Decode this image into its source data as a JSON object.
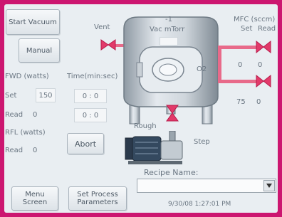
{
  "buttons": {
    "start_vacuum": "Start Vacuum",
    "manual": "Manual",
    "abort": "Abort",
    "menu_screen": "Menu Screen",
    "set_process_parameters": "Set Process Parameters"
  },
  "labels": {
    "vent": "Vent",
    "vac": "Vac mTorr",
    "vac_value": "-1",
    "mfc_header": "MFC (sccm)",
    "mfc_set": "Set",
    "mfc_read": "Read",
    "fwd": "FWD (watts)",
    "time": "Time(min:sec)",
    "set": "Set",
    "read_fwd": "Read",
    "rfl": "RFL (watts)",
    "read_rfl": "Read",
    "rough": "Rough",
    "step": "Step",
    "o2": "O2",
    "recipe_name": "Recipe Name:",
    "timestamp": "9/30/08 1:27:01 PM"
  },
  "values": {
    "fwd_set": "150",
    "fwd_read": "0",
    "rfl_read": "0",
    "time_set": "0 : 0",
    "time_read": "0 : 0",
    "mfc1_set": "0",
    "mfc1_read": "0",
    "mfc2_set": "75",
    "mfc2_read": "0",
    "recipe_value": ""
  },
  "colors": {
    "frame": "#cc1670",
    "pipe": "#e86a8a",
    "valve": "#e23a6a"
  }
}
